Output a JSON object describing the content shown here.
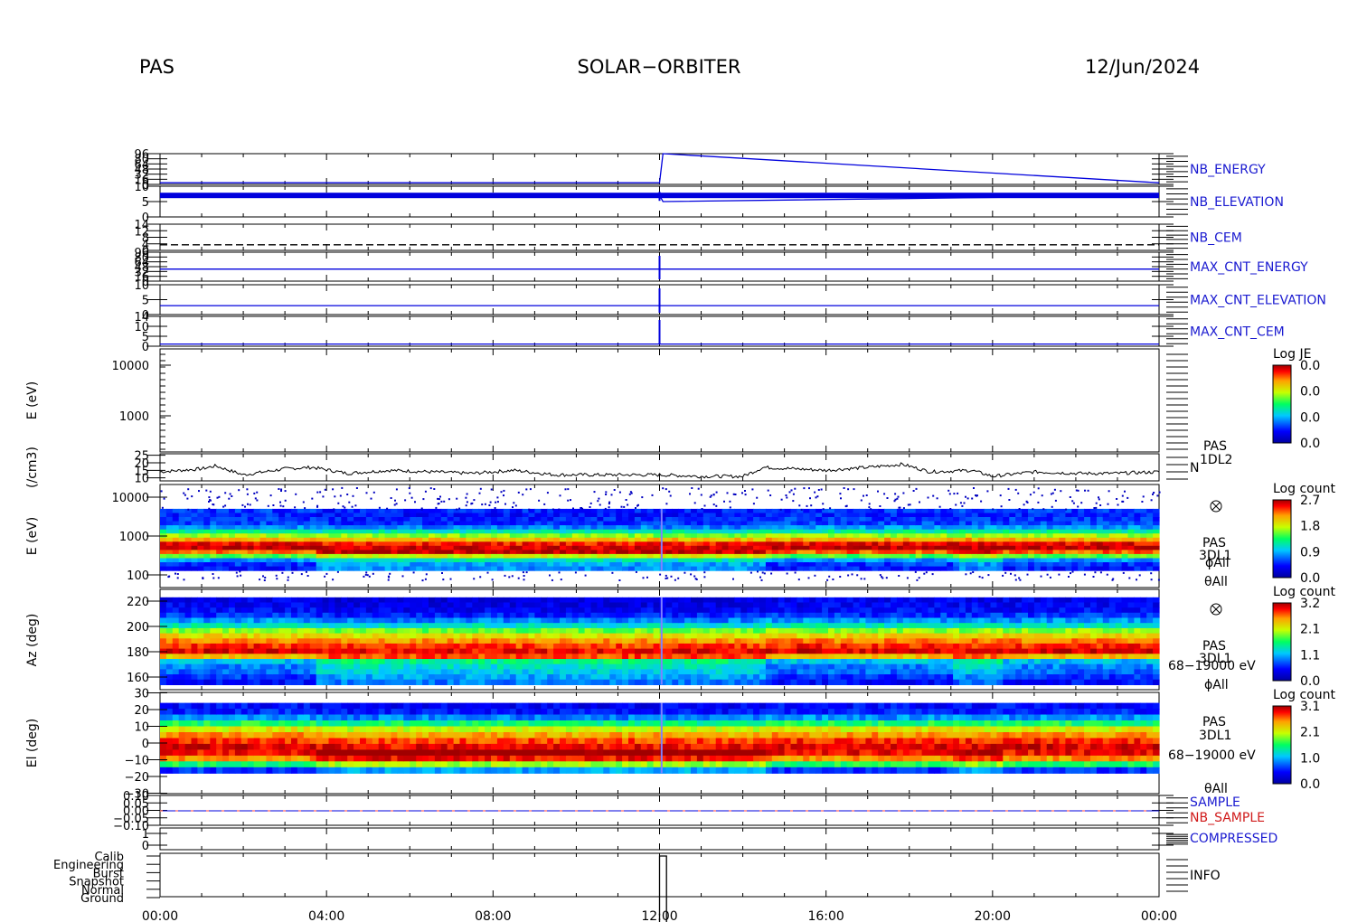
{
  "header": {
    "instrument": "PAS",
    "mission": "SOLAR−ORBITER",
    "date": "12/Jun/2024"
  },
  "colors": {
    "blue_label": "#1a1ad0",
    "red_label": "#d01a1a",
    "trace_blue": "#0000dd"
  },
  "chart_data": [
    {
      "type": "line",
      "name": "NB_ENERGY",
      "tick_labels": [
        "96",
        "80",
        "64",
        "48",
        "32",
        "16",
        "0"
      ],
      "x": [
        "00:00",
        "12:00",
        "12:05",
        "24:00"
      ],
      "values": [
        5,
        5,
        96,
        5
      ]
    },
    {
      "type": "line",
      "name": "NB_ELEVATION",
      "tick_labels": [
        "10",
        "5",
        "0"
      ],
      "x": [
        "00:00",
        "12:00",
        "12:05",
        "24:00"
      ],
      "values": [
        7,
        7,
        5,
        7
      ]
    },
    {
      "type": "line",
      "name": "NB_CEM",
      "tick_labels": [
        "14",
        "12",
        "8",
        "4",
        "0"
      ],
      "x": [
        "00:00",
        "24:00"
      ],
      "values": [
        3,
        3
      ],
      "style": "dashed"
    },
    {
      "type": "line",
      "name": "MAX_CNT_ENERGY",
      "tick_labels": [
        "96",
        "80",
        "64",
        "48",
        "32",
        "16",
        "0"
      ],
      "x": [
        "00:00",
        "24:00"
      ],
      "values": [
        40,
        40
      ]
    },
    {
      "type": "line",
      "name": "MAX_CNT_ELEVATION",
      "tick_labels": [
        "10",
        "5",
        "0"
      ],
      "x": [
        "00:00",
        "24:00"
      ],
      "values": [
        3,
        3
      ]
    },
    {
      "type": "line",
      "name": "MAX_CNT_CEM",
      "tick_labels": [
        "14",
        "10",
        "5",
        "0"
      ],
      "x": [
        "00:00",
        "24:00"
      ],
      "values": [
        1,
        1
      ]
    },
    {
      "type": "heatmap",
      "name": "PAS 1DL2 energy spectrum",
      "ylabel": "E (eV)",
      "yscale": "log",
      "ylim": [
        600,
        20000
      ],
      "ytick_labels": [
        "10000",
        "1000"
      ],
      "colorbar": {
        "title": "Log JE",
        "tick_labels": [
          "0.0",
          "0.0",
          "0.0",
          "0.0"
        ]
      }
    },
    {
      "type": "line",
      "name": "N",
      "ylabel": "(/cm3)",
      "ytick_labels": [
        "25",
        "20",
        "15",
        "10"
      ],
      "ylim": [
        8,
        26
      ],
      "side_label": "PAS 1DL2",
      "series_label": "N",
      "x": [
        "00:00",
        "00:30",
        "01:00",
        "01:20",
        "02:00",
        "03:00",
        "03:40",
        "04:30",
        "05:30",
        "06:30",
        "07:30",
        "08:30",
        "09:30",
        "10:30",
        "12:00",
        "13:00",
        "14:00",
        "14:30",
        "16:00",
        "17:00",
        "17:50",
        "18:30",
        "19:30",
        "20:00",
        "21:00",
        "22:00",
        "23:00",
        "24:00"
      ],
      "values": [
        14,
        15,
        16,
        18,
        12,
        16,
        17,
        13,
        15,
        14,
        13,
        15,
        12,
        12,
        12,
        11,
        11,
        17,
        15,
        17,
        19,
        14,
        15,
        11,
        14,
        13,
        13,
        14
      ]
    },
    {
      "type": "heatmap",
      "name": "PAS 3DL1 energy",
      "ylabel": "E (eV)",
      "yscale": "log",
      "ylim": [
        80,
        18000
      ],
      "ytick_labels": [
        "10000",
        "1000",
        "100"
      ],
      "side_label": [
        "PAS",
        "3DL1",
        "ϕAll",
        "θAll"
      ],
      "colorbar": {
        "title": "Log count",
        "tick_labels": [
          "2.7",
          "1.8",
          "0.9",
          "0.0"
        ]
      }
    },
    {
      "type": "heatmap",
      "name": "PAS 3DL1 azimuth",
      "ylabel": "Az (deg)",
      "ylim": [
        150,
        225
      ],
      "ytick_labels": [
        "220",
        "200",
        "180",
        "160"
      ],
      "side_label": [
        "PAS",
        "3DL1",
        "68−19000 eV",
        "ϕAll"
      ],
      "colorbar": {
        "title": "Log count",
        "tick_labels": [
          "3.2",
          "2.1",
          "1.1",
          "0.0"
        ]
      }
    },
    {
      "type": "heatmap",
      "name": "PAS 3DL1 elevation",
      "ylabel": "El (deg)",
      "ylim": [
        -30,
        30
      ],
      "ytick_labels": [
        "30",
        "20",
        "10",
        "0",
        "−10",
        "−20",
        "−30"
      ],
      "side_label": [
        "PAS",
        "3DL1",
        "68−19000 eV",
        "θAll"
      ],
      "colorbar": {
        "title": "Log count",
        "tick_labels": [
          "3.1",
          "2.1",
          "1.0",
          "0.0"
        ]
      }
    },
    {
      "type": "line",
      "name": "SAMPLE / NB_SAMPLE",
      "ytick_labels": [
        "0.10",
        "0.05",
        "0.00",
        "−0.05",
        "−0.10"
      ],
      "series": [
        {
          "name": "SAMPLE",
          "values": [
            0,
            0
          ]
        },
        {
          "name": "NB_SAMPLE",
          "values": [
            0,
            0
          ]
        }
      ],
      "x": [
        "00:00",
        "24:00"
      ]
    },
    {
      "type": "line",
      "name": "COMPRESSED",
      "ytick_labels": [
        "1",
        "0"
      ],
      "x": [
        "00:00",
        "24:00"
      ],
      "values": [
        0,
        0
      ]
    },
    {
      "type": "line",
      "name": "INFO",
      "ytick_labels": [
        "Calib",
        "Engineering",
        "Burst",
        "Snapshot",
        "Normal",
        "Ground"
      ],
      "x": [
        "00:00",
        "12:00",
        "12:00",
        "12:10",
        "12:10",
        "24:00"
      ],
      "values": [
        "Ground",
        "Ground",
        "Calib",
        "Calib",
        "Ground",
        "Ground"
      ]
    }
  ],
  "x_axis": {
    "tick_labels": [
      "00:00",
      "04:00",
      "08:00",
      "12:00",
      "16:00",
      "20:00",
      "00:00"
    ]
  }
}
